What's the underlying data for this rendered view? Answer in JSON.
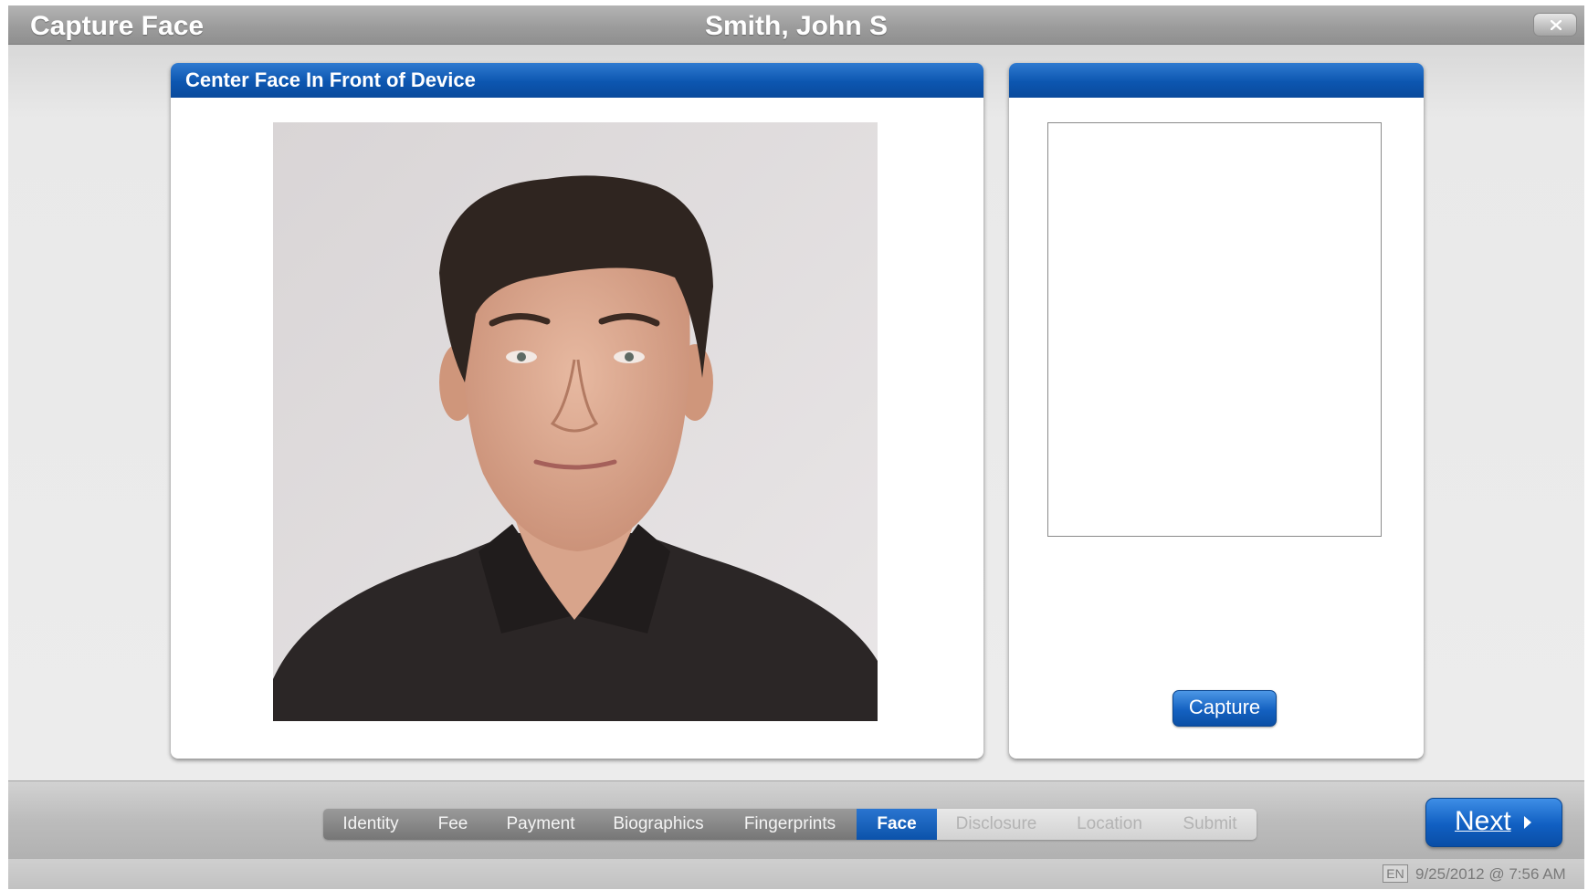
{
  "titlebar": {
    "app_title": "Capture Face",
    "patient_name": "Smith, John S",
    "close_icon": "close-icon"
  },
  "left_panel": {
    "header": "Center Face In Front of Device",
    "camera_feed": "live-camera-feed"
  },
  "right_panel": {
    "header": "",
    "capture_label": "Capture"
  },
  "steps": [
    {
      "label": "Identity",
      "state": "done"
    },
    {
      "label": "Fee",
      "state": "done"
    },
    {
      "label": "Payment",
      "state": "done"
    },
    {
      "label": "Biographics",
      "state": "done"
    },
    {
      "label": "Fingerprints",
      "state": "done"
    },
    {
      "label": "Face",
      "state": "active"
    },
    {
      "label": "Disclosure",
      "state": "todo"
    },
    {
      "label": "Location",
      "state": "todo"
    },
    {
      "label": "Submit",
      "state": "todo"
    }
  ],
  "next_label": "Next",
  "status": {
    "language": "EN",
    "datetime": "9/25/2012 @ 7:56 AM"
  },
  "colors": {
    "accent_blue": "#0c56b0",
    "titlebar_gray": "#9c9c9c",
    "background": "#e4e4e4"
  }
}
